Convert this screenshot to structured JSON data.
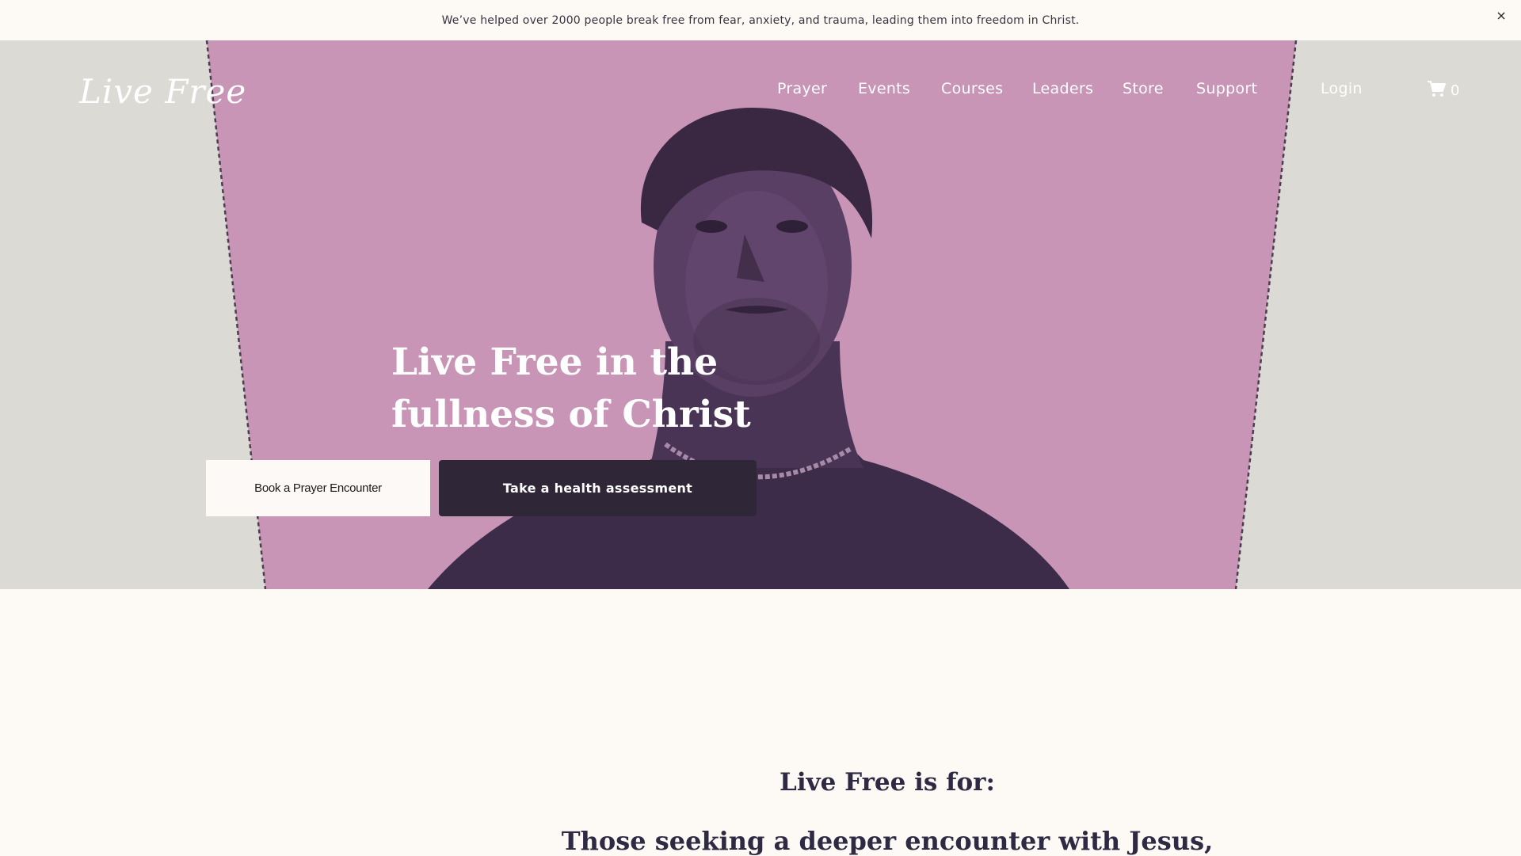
{
  "announcement": {
    "text": "We’ve helped over 2000 people break free from fear, anxiety, and trauma, leading them into freedom in Christ.",
    "close_label": "×"
  },
  "header": {
    "logo_text": "Live Free",
    "nav": [
      {
        "label": "Prayer"
      },
      {
        "label": "Events"
      },
      {
        "label": "Courses"
      },
      {
        "label": "Leaders"
      },
      {
        "label": "Store"
      },
      {
        "label": "Support"
      }
    ],
    "login_label": "Login",
    "cart_count": "0",
    "cart_icon": "cart-icon"
  },
  "hero": {
    "headline_line1": "Live Free in the",
    "headline_line2": "fullness of Christ",
    "book_button": "Book a Prayer Encounter",
    "assessment_button": "Take a health assessment",
    "colors": {
      "panel": "#c895b6",
      "backdrop": "#dcdad5",
      "figure": "#3d2c49"
    }
  },
  "intro": {
    "title": "Live Free is for:",
    "first_line": "Those seeking a deeper encounter with Jesus,"
  }
}
